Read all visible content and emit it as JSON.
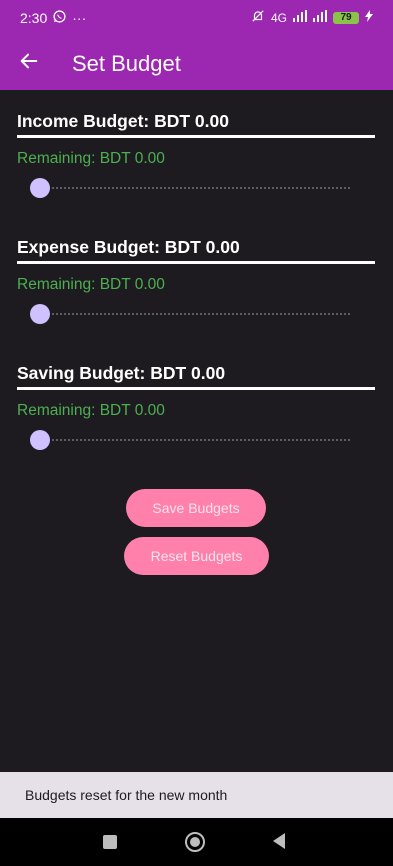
{
  "status_bar": {
    "time": "2:30",
    "left_icons": [
      "whatsapp-icon",
      "more-notifications-icon"
    ],
    "overflow": "···",
    "network": "4G",
    "battery": "79"
  },
  "app_bar": {
    "title": "Set Budget",
    "back_icon": "arrow-left-icon",
    "color": "#9c27b0"
  },
  "budgets": [
    {
      "title": "Income Budget: BDT 0.00",
      "remaining": "Remaining: BDT 0.00",
      "slider_value": 0
    },
    {
      "title": "Expense Budget: BDT 0.00",
      "remaining": "Remaining: BDT 0.00",
      "slider_value": 0
    },
    {
      "title": "Saving Budget: BDT 0.00",
      "remaining": "Remaining: BDT 0.00",
      "slider_value": 0
    }
  ],
  "buttons": {
    "save": "Save Budgets",
    "reset": "Reset Budgets",
    "color": "#ff80ab"
  },
  "snackbar": {
    "message": "Budgets reset for the new month"
  },
  "nav_bar": {
    "icons": [
      "recents-icon",
      "home-icon",
      "back-icon"
    ]
  }
}
